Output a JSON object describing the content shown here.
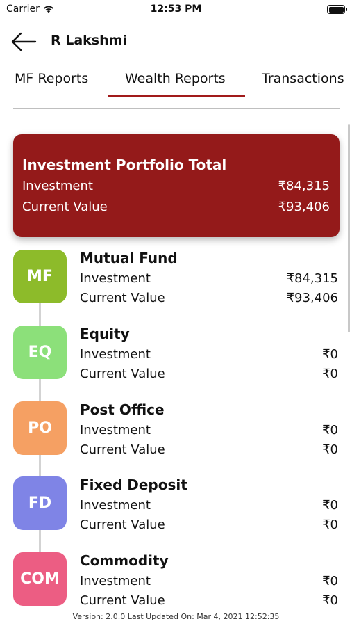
{
  "status_bar": {
    "carrier": "Carrier",
    "time": "12:53 PM"
  },
  "nav": {
    "title": "R Lakshmi"
  },
  "tabs": [
    {
      "label": "MF Reports"
    },
    {
      "label": "Wealth Reports",
      "active": true
    },
    {
      "label": "Transactions"
    }
  ],
  "portfolio": {
    "title": "Investment Portfolio Total",
    "investment_label": "Investment",
    "investment_value": "₹84,315",
    "current_label": "Current Value",
    "current_value": "₹93,406"
  },
  "assets": [
    {
      "badge": "MF",
      "name": "Mutual Fund",
      "investment_label": "Investment",
      "investment_value": "₹84,315",
      "current_label": "Current Value",
      "current_value": "₹93,406",
      "color": "#8dbb2a"
    },
    {
      "badge": "EQ",
      "name": "Equity",
      "investment_label": "Investment",
      "investment_value": "₹0",
      "current_label": "Current Value",
      "current_value": "₹0",
      "color": "#8ce07a"
    },
    {
      "badge": "PO",
      "name": "Post Office",
      "investment_label": "Investment",
      "investment_value": "₹0",
      "current_label": "Current Value",
      "current_value": "₹0",
      "color": "#f5a063"
    },
    {
      "badge": "FD",
      "name": "Fixed Deposit",
      "investment_label": "Investment",
      "investment_value": "₹0",
      "current_label": "Current Value",
      "current_value": "₹0",
      "color": "#7f84e6"
    },
    {
      "badge": "COM",
      "name": "Commodity",
      "investment_label": "Investment",
      "investment_value": "₹0",
      "current_label": "Current Value",
      "current_value": "₹0",
      "color": "#ec5d83"
    }
  ],
  "footer": {
    "version_text": "Version: 2.0.0 Last Updated On: Mar 4, 2021 12:52:35"
  },
  "colors": {
    "accent": "#a11a1a",
    "card": "#941a1a"
  }
}
